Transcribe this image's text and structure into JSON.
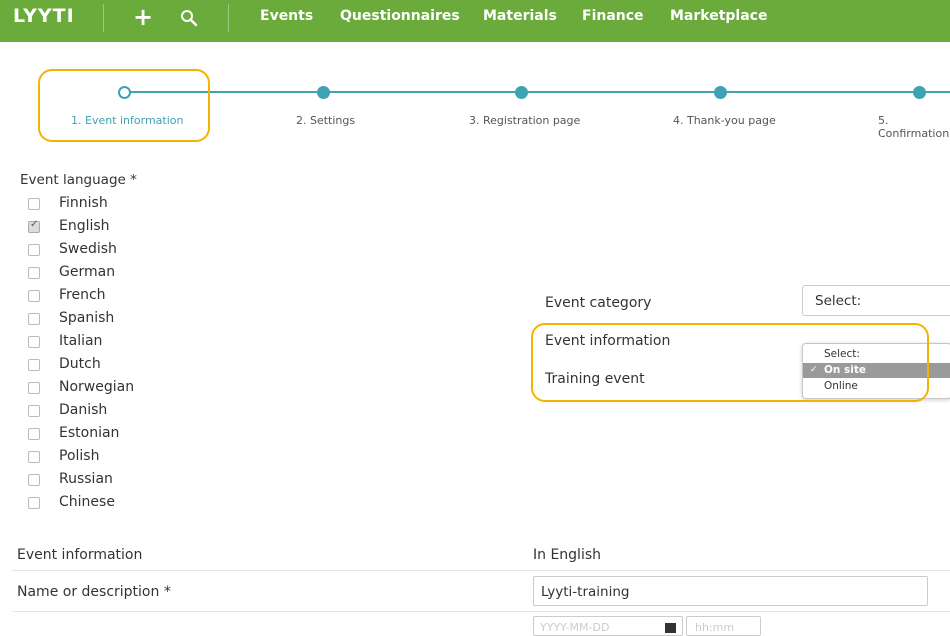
{
  "header": {
    "logo": "LYYTI",
    "add_icon_glyph": "+",
    "nav": [
      "Events",
      "Questionnaires",
      "Materials",
      "Finance",
      "Marketplace"
    ],
    "colors": {
      "bar": "#6aab3b",
      "accent": "#3fa2b4",
      "highlight": "#f2b400"
    }
  },
  "steps": [
    {
      "label": "1. Event information",
      "current": true
    },
    {
      "label": "2. Settings"
    },
    {
      "label": "3. Registration page"
    },
    {
      "label": "4. Thank-you page"
    },
    {
      "label": "5. Confirmation"
    }
  ],
  "languages": {
    "title": "Event language *",
    "items": [
      {
        "label": "Finnish",
        "checked": false
      },
      {
        "label": "English",
        "checked": true
      },
      {
        "label": "Swedish",
        "checked": false
      },
      {
        "label": "German",
        "checked": false
      },
      {
        "label": "French",
        "checked": false
      },
      {
        "label": "Spanish",
        "checked": false
      },
      {
        "label": "Italian",
        "checked": false
      },
      {
        "label": "Dutch",
        "checked": false
      },
      {
        "label": "Norwegian",
        "checked": false
      },
      {
        "label": "Danish",
        "checked": false
      },
      {
        "label": "Estonian",
        "checked": false
      },
      {
        "label": "Polish",
        "checked": false
      },
      {
        "label": "Russian",
        "checked": false
      },
      {
        "label": "Chinese",
        "checked": false
      }
    ]
  },
  "category": {
    "label": "Event category",
    "select_value": "Select:",
    "event_info_label": "Event information",
    "training_label": "Training event",
    "dropdown": {
      "options": [
        "Select:",
        "On site",
        "Online"
      ],
      "selected": "On site"
    }
  },
  "table": {
    "header_left": "Event information",
    "header_right": "In English",
    "name_label": "Name or description *",
    "name_value": "Lyyti-training",
    "date_placeholder": "YYYY-MM-DD",
    "time_placeholder": "hh:mm"
  }
}
